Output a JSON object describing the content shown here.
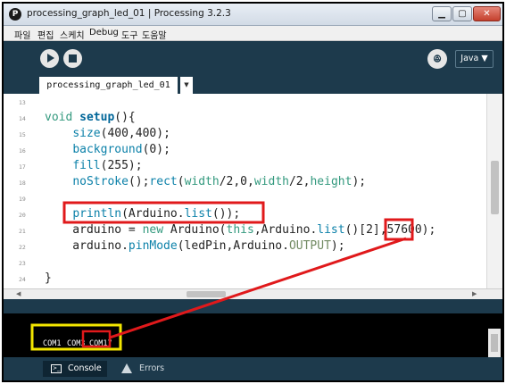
{
  "window": {
    "title": "processing_graph_led_01 | Processing 3.2.3",
    "app_icon": "processing-icon",
    "controls": {
      "minimize": "▁",
      "maximize": "▢",
      "close": "✕"
    }
  },
  "menu": [
    "파일",
    "편집",
    "스케치",
    "Debug",
    "도구",
    "도움말"
  ],
  "toolbar": {
    "run_icon": "play-icon",
    "stop_icon": "stop-icon",
    "debug_icon": "butterfly-icon",
    "debug_glyph": "ꔮ",
    "mode_label": "Java ▼"
  },
  "tabs": {
    "active": "processing_graph_led_01",
    "menu_glyph": "▼"
  },
  "editor": {
    "lines": [
      {
        "no": "13",
        "text": ""
      },
      {
        "no": "14",
        "text": "void setup(){"
      },
      {
        "no": "15",
        "text": "    size(400,400);"
      },
      {
        "no": "16",
        "text": "    background(0);"
      },
      {
        "no": "17",
        "text": "    fill(255);"
      },
      {
        "no": "18",
        "text": "    noStroke();rect(width/2,0,width/2,height);"
      },
      {
        "no": "19",
        "text": ""
      },
      {
        "no": "20",
        "text": "    println(Arduino.list());"
      },
      {
        "no": "21",
        "text": "    arduino = new Arduino(this,Arduino.list()[2],57600);"
      },
      {
        "no": "22",
        "text": "    arduino.pinMode(ledPin,Arduino.OUTPUT);"
      },
      {
        "no": "23",
        "text": ""
      },
      {
        "no": "24",
        "text": "}"
      }
    ]
  },
  "hscroll": {
    "left": "◀",
    "right": "▶"
  },
  "console": {
    "ports": [
      "COM1",
      "COM3",
      "COM17"
    ]
  },
  "bottom_tabs": {
    "console": "Console",
    "errors": "Errors",
    "console_icon": "console-icon",
    "errors_icon": "warning-icon"
  },
  "colors": {
    "chrome": "#1d3a4c",
    "annotation_red": "#e0191b",
    "annotation_yellow": "#f3e600",
    "keyword": "#33997e",
    "function": "#006699"
  }
}
